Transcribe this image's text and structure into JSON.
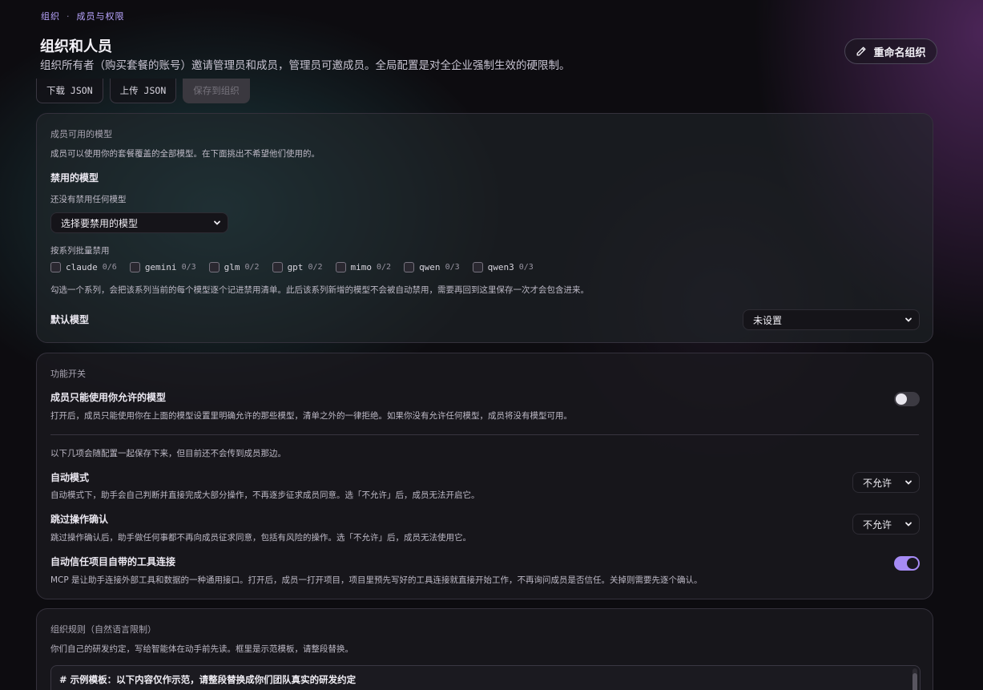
{
  "breadcrumb": {
    "items": [
      "组织",
      "成员与权限"
    ],
    "separator": "·"
  },
  "header": {
    "title": "组织和人员",
    "subtitle": "组织所有者（购买套餐的账号）邀请管理员和成员，管理员可邀成员。全局配置是对全企业强制生效的硬限制。",
    "rename_label": "重命名组织"
  },
  "toolbar": {
    "download_label": "下载 JSON",
    "upload_label": "上传 JSON",
    "save_label": "保存到组织",
    "save_disabled": true
  },
  "models_card": {
    "section_label": "成员可用的模型",
    "description": "成员可以使用你的套餐覆盖的全部模型。在下面挑出不希望他们使用的。",
    "disabled_title": "禁用的模型",
    "disabled_empty": "还没有禁用任何模型",
    "disabled_select": "选择要禁用的模型",
    "family_label": "按系列批量禁用",
    "families": [
      {
        "name": "claude",
        "count": "0/6",
        "checked": false
      },
      {
        "name": "gemini",
        "count": "0/3",
        "checked": false
      },
      {
        "name": "glm",
        "count": "0/2",
        "checked": false
      },
      {
        "name": "gpt",
        "count": "0/2",
        "checked": false
      },
      {
        "name": "mimo",
        "count": "0/2",
        "checked": false
      },
      {
        "name": "qwen",
        "count": "0/3",
        "checked": false
      },
      {
        "name": "qwen3",
        "count": "0/3",
        "checked": false
      }
    ],
    "family_note": "勾选一个系列，会把该系列当前的每个模型逐个记进禁用清单。此后该系列新增的模型不会被自动禁用，需要再回到这里保存一次才会包含进来。",
    "default_label": "默认模型",
    "default_value": "未设置"
  },
  "features_card": {
    "section_label": "功能开关",
    "allowlist": {
      "title": "成员只能使用你允许的模型",
      "description": "打开后，成员只能使用你在上面的模型设置里明确允许的那些模型，清单之外的一律拒绝。如果你没有允许任何模型，成员将没有模型可用。",
      "enabled": false
    },
    "pending_note": "以下几项会随配置一起保存下来，但目前还不会传到成员那边。",
    "auto_mode": {
      "title": "自动模式",
      "description": "自动模式下，助手会自己判断并直接完成大部分操作，不再逐步征求成员同意。选「不允许」后，成员无法开启它。",
      "value": "不允许"
    },
    "skip_confirm": {
      "title": "跳过操作确认",
      "description": "跳过操作确认后，助手做任何事都不再向成员征求同意，包括有风险的操作。选「不允许」后，成员无法使用它。",
      "value": "不允许"
    },
    "trust_tools": {
      "title": "自动信任项目自带的工具连接",
      "description": "MCP 是让助手连接外部工具和数据的一种通用接口。打开后，成员一打开项目，项目里预先写好的工具连接就直接开始工作，不再询问成员是否信任。关掉则需要先逐个确认。",
      "enabled": true
    }
  },
  "rules_card": {
    "section_label": "组织规则（自然语言限制）",
    "description": "你们自己的研发约定，写给智能体在动手前先读。框里是示范模板，请整段替换。",
    "textarea_value": "# 示例模板：以下内容仅作示范，请整段替换成你们团队真实的研发约定"
  },
  "colors": {
    "accent": "#a68bf5",
    "breadcrumb": "#b9a5ff"
  }
}
